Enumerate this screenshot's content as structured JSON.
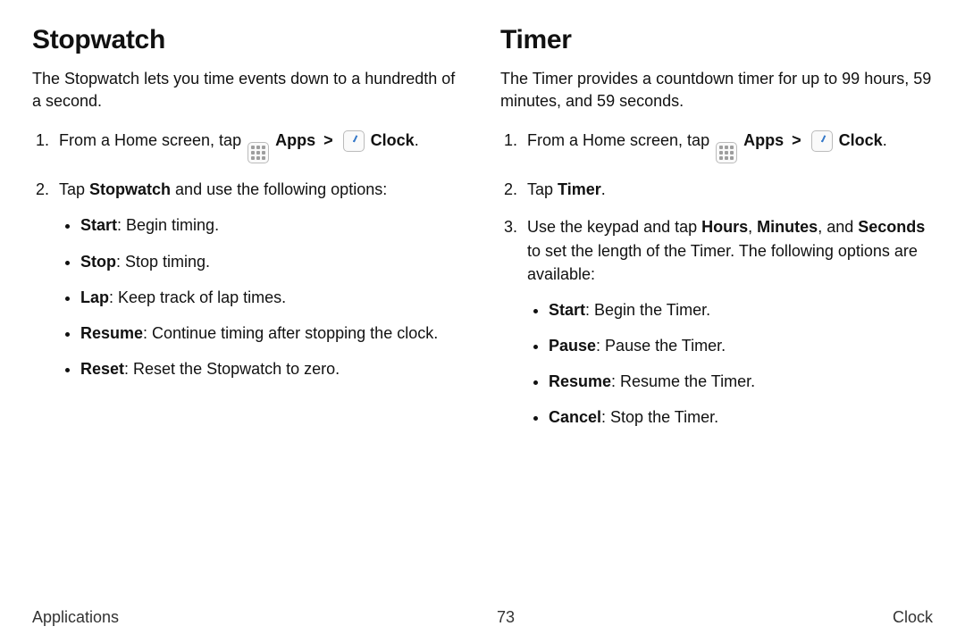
{
  "footer": {
    "left": "Applications",
    "page_no": "73",
    "right": "Clock"
  },
  "nav": {
    "apps_label": "Apps",
    "chevron": ">",
    "clock_label": "Clock"
  },
  "left": {
    "heading": "Stopwatch",
    "intro": "The Stopwatch lets you time events down to a hundredth of a second.",
    "step1_prefix": "From a Home screen, tap ",
    "step2_prefix": "Tap ",
    "step2_bold": "Stopwatch",
    "step2_suffix": " and use the following options:",
    "bullets": [
      {
        "term": "Start",
        "desc": ": Begin timing."
      },
      {
        "term": "Stop",
        "desc": ": Stop timing."
      },
      {
        "term": "Lap",
        "desc": ": Keep track of lap times."
      },
      {
        "term": "Resume",
        "desc": ": Continue timing after stopping the clock."
      },
      {
        "term": "Reset",
        "desc": ": Reset the Stopwatch to zero."
      }
    ]
  },
  "right": {
    "heading": "Timer",
    "intro": "The Timer provides a countdown timer for up to 99 hours, 59 minutes, and 59 seconds.",
    "step1_prefix": "From a Home screen, tap ",
    "step2_prefix": "Tap ",
    "step2_bold": "Timer",
    "step2_suffix": ".",
    "step3_p1": "Use the keypad and tap ",
    "step3_b1": "Hours",
    "step3_p2": ", ",
    "step3_b2": "Minutes",
    "step3_p3": ", and ",
    "step3_b3": "Seconds",
    "step3_p4": " to set the length of the Timer. The following options are available:",
    "bullets": [
      {
        "term": "Start",
        "desc": ": Begin the Timer."
      },
      {
        "term": "Pause",
        "desc": ": Pause the Timer."
      },
      {
        "term": "Resume",
        "desc": ": Resume the Timer."
      },
      {
        "term": "Cancel",
        "desc": ": Stop the Timer."
      }
    ]
  }
}
